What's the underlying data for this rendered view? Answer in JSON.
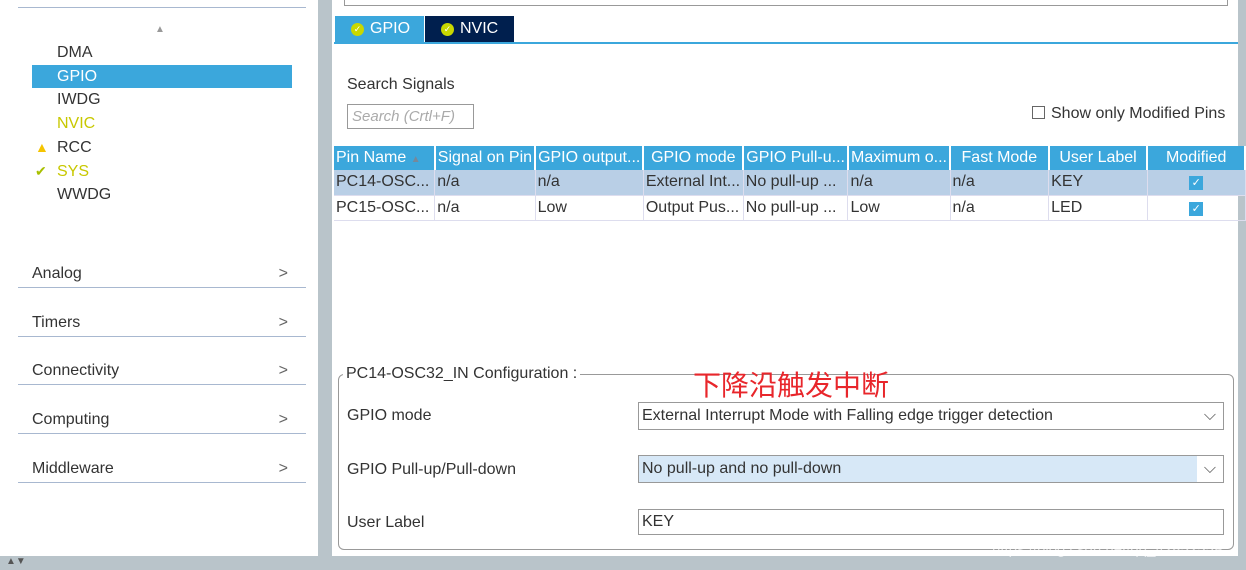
{
  "sidebar": {
    "items": [
      {
        "label": "DMA",
        "state": "normal"
      },
      {
        "label": "GPIO",
        "state": "selected"
      },
      {
        "label": "IWDG",
        "state": "normal"
      },
      {
        "label": "NVIC",
        "state": "configured"
      },
      {
        "label": "RCC",
        "state": "warning",
        "icon": "warning-icon"
      },
      {
        "label": "SYS",
        "state": "ok",
        "icon": "check-icon"
      },
      {
        "label": "WWDG",
        "state": "normal"
      }
    ],
    "categories": [
      "Analog",
      "Timers",
      "Connectivity",
      "Computing",
      "Middleware"
    ]
  },
  "tabs": [
    {
      "label": "GPIO",
      "active": true
    },
    {
      "label": "NVIC",
      "active": false
    }
  ],
  "search": {
    "label": "Search Signals",
    "placeholder": "Search (Crtl+F)"
  },
  "show_modified": {
    "label": "Show only Modified Pins",
    "checked": false
  },
  "table": {
    "headers": [
      "Pin Name",
      "Signal on Pin",
      "GPIO output...",
      "GPIO mode",
      "GPIO Pull-u...",
      "Maximum o...",
      "Fast Mode",
      "User Label",
      "Modified"
    ],
    "rows": [
      [
        "PC14-OSC...",
        "n/a",
        "n/a",
        "External Int...",
        "No pull-up ...",
        "n/a",
        "n/a",
        "KEY",
        true
      ],
      [
        "PC15-OSC...",
        "n/a",
        "Low",
        "Output Pus...",
        "No pull-up ...",
        "Low",
        "n/a",
        "LED",
        true
      ]
    ]
  },
  "config": {
    "title": "PC14-OSC32_IN Configuration :",
    "annotation": "下降沿触发中断",
    "gpio_mode_label": "GPIO mode",
    "gpio_mode_value": "External Interrupt Mode with Falling edge trigger detection",
    "pull_label": "GPIO Pull-up/Pull-down",
    "pull_value": "No pull-up and no pull-down",
    "user_label_label": "User Label",
    "user_label_value": "KEY"
  },
  "watermark": "https://blog.csdn.net/qq_42852559",
  "colors": {
    "accent": "#3ba7dc",
    "tab_dark": "#001f4e",
    "annotation": "#e8262b",
    "ok": "#c8c800"
  }
}
